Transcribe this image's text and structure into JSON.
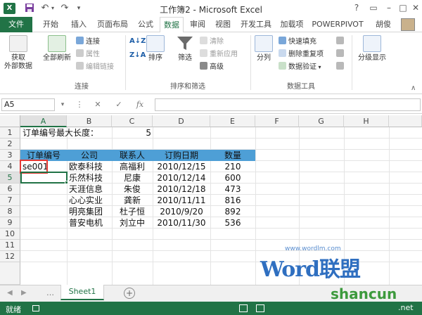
{
  "window": {
    "title": "工作簿2 - Microsoft Excel",
    "user": "胡俊"
  },
  "tabs": [
    "文件",
    "开始",
    "插入",
    "页面布局",
    "公式",
    "数据",
    "审阅",
    "视图",
    "开发工具",
    "加载项",
    "POWERPIVOT"
  ],
  "ribbon": {
    "get_external": "获取\n外部数据",
    "refresh_all": "全部刷新",
    "connections_items": [
      "连接",
      "属性",
      "编辑链接"
    ],
    "group_connections": "连接",
    "sort_az": "A↓Z",
    "sort_za": "Z↓A",
    "sort": "排序",
    "filter": "筛选",
    "filter_items": [
      "清除",
      "重新应用",
      "高级"
    ],
    "group_sort_filter": "排序和筛选",
    "split": "分列",
    "tools_items": [
      "快速填充",
      "删除重复项",
      "数据验证"
    ],
    "group_tools": "数据工具",
    "outline": "分级显示"
  },
  "formula_bar": {
    "name_box": "A5",
    "fx": "fx",
    "formula": ""
  },
  "columns": [
    "A",
    "B",
    "C",
    "D",
    "E",
    "F",
    "G",
    "H"
  ],
  "rows": [
    "1",
    "2",
    "3",
    "4",
    "5",
    "6",
    "7",
    "8",
    "9",
    "10",
    "11",
    "12"
  ],
  "cells": {
    "a1": "订单编号最大长度：",
    "c1": "5",
    "headers": [
      "订单编号",
      "公司",
      "联系人",
      "订购日期",
      "数量"
    ],
    "a4": "se001",
    "table": [
      [
        "欧泰科技",
        "高福利",
        "2010/12/15",
        "210"
      ],
      [
        "乐然科技",
        "尼康",
        "2010/12/14",
        "600"
      ],
      [
        "天涯信息",
        "朱俊",
        "2010/12/18",
        "473"
      ],
      [
        "心心实业",
        "龚新",
        "2010/11/11",
        "816"
      ],
      [
        "明亮集团",
        "杜子恒",
        "2010/9/20",
        "892"
      ],
      [
        "普安电机",
        "刘立中",
        "2010/11/30",
        "536"
      ]
    ]
  },
  "sheet_tabs": [
    "Sheet1"
  ],
  "status": {
    "ready": "就绪"
  },
  "watermarks": [
    "www.wordlm.com",
    "Word联盟",
    "shancun",
    ".net"
  ],
  "colors": {
    "accent": "#217346",
    "table_header": "#4e9fd6",
    "highlight_box": "#e53935"
  }
}
